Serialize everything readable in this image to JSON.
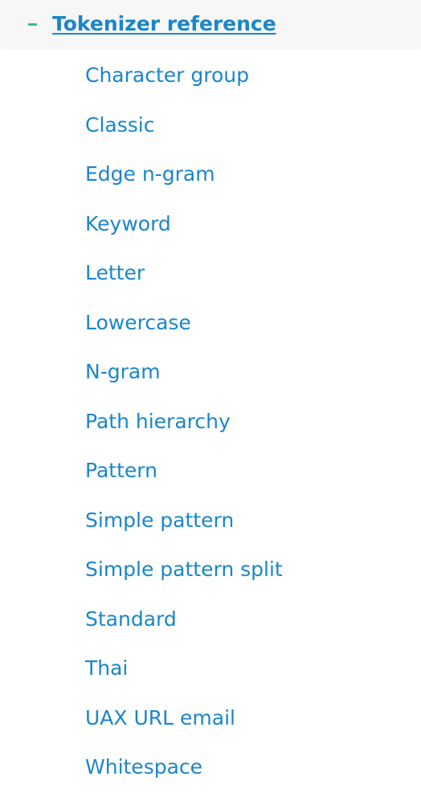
{
  "section": {
    "title": "Tokenizer reference",
    "toggle_icon": "minus-icon",
    "toggle_color": "#38b39a",
    "link_color": "#1a86c9",
    "items": [
      {
        "label": "Character group"
      },
      {
        "label": "Classic"
      },
      {
        "label": "Edge n-gram"
      },
      {
        "label": "Keyword"
      },
      {
        "label": "Letter"
      },
      {
        "label": "Lowercase"
      },
      {
        "label": "N-gram"
      },
      {
        "label": "Path hierarchy"
      },
      {
        "label": "Pattern"
      },
      {
        "label": "Simple pattern"
      },
      {
        "label": "Simple pattern split"
      },
      {
        "label": "Standard"
      },
      {
        "label": "Thai"
      },
      {
        "label": "UAX URL email"
      },
      {
        "label": "Whitespace"
      }
    ]
  }
}
